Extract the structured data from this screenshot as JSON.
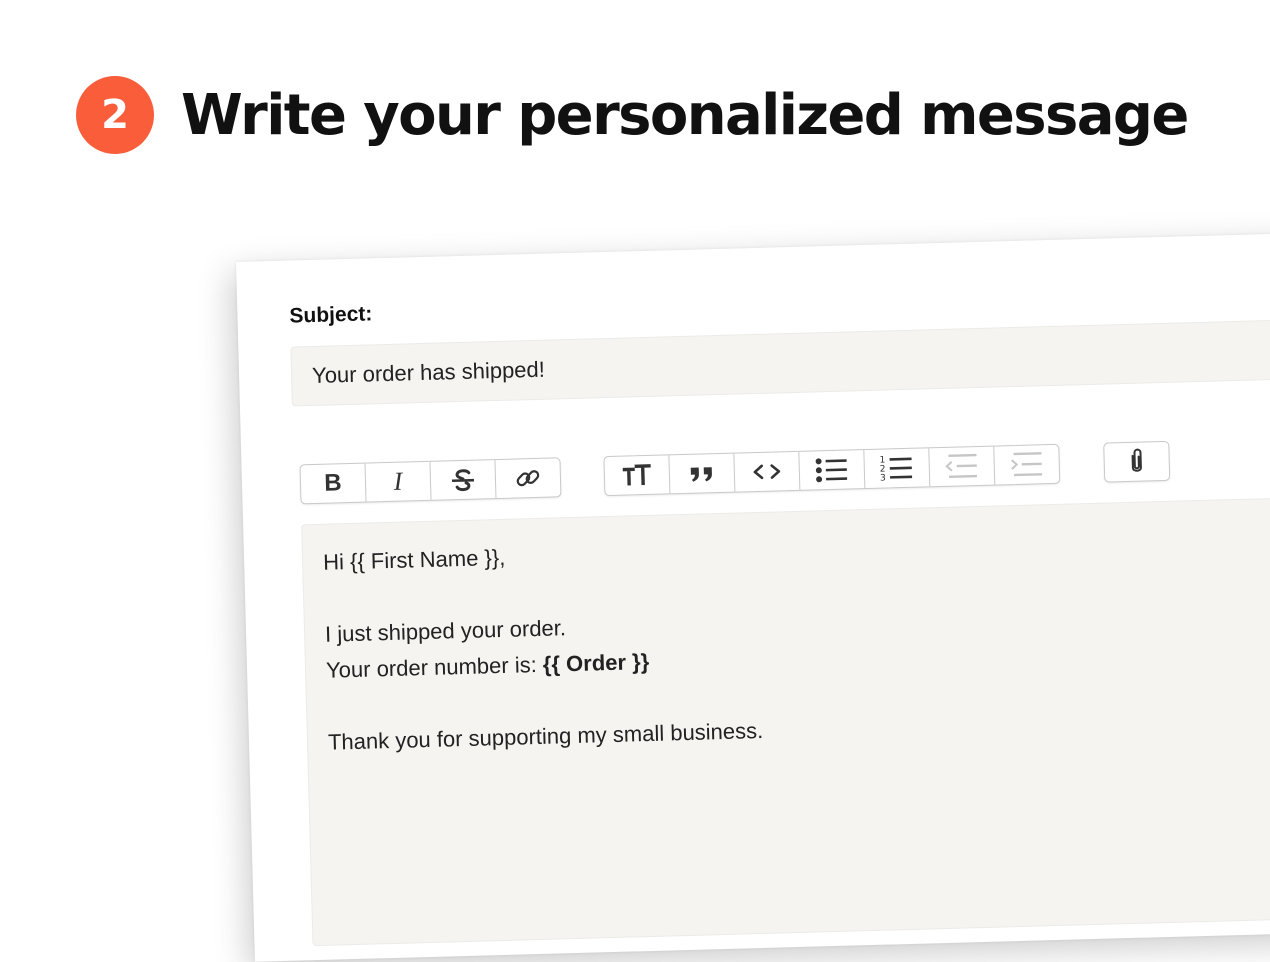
{
  "heading": {
    "step_number": "2",
    "title": "Write your personalized message"
  },
  "editor": {
    "subject_label": "Subject:",
    "subject_value": "Your order has shipped!",
    "toolbar": {
      "group1": [
        {
          "name": "bold",
          "label": "B",
          "icon": "bold-icon"
        },
        {
          "name": "italic",
          "label": "I",
          "icon": "italic-icon"
        },
        {
          "name": "strikethrough",
          "icon": "strikethrough-icon"
        },
        {
          "name": "link",
          "icon": "link-icon"
        }
      ],
      "group2": [
        {
          "name": "heading",
          "icon": "heading-icon"
        },
        {
          "name": "quote",
          "icon": "quote-icon"
        },
        {
          "name": "code",
          "label": "<>",
          "icon": "code-icon"
        },
        {
          "name": "bullet-list",
          "icon": "bullet-list-icon"
        },
        {
          "name": "numbered-list",
          "icon": "numbered-list-icon"
        },
        {
          "name": "decrease-indent",
          "icon": "outdent-icon",
          "disabled": true
        },
        {
          "name": "increase-indent",
          "icon": "indent-icon",
          "disabled": true
        }
      ],
      "group3": [
        {
          "name": "attach",
          "icon": "paperclip-icon"
        }
      ]
    },
    "body": {
      "greeting": "Hi {{ First Name }},",
      "line1": "I just shipped your order.",
      "line2_prefix": "Your order number is: ",
      "line2_tag": "{{ Order }}",
      "line3": "Thank you for supporting my small business."
    }
  },
  "colors": {
    "accent": "#f95d3a",
    "field_bg": "#f5f4f1"
  }
}
